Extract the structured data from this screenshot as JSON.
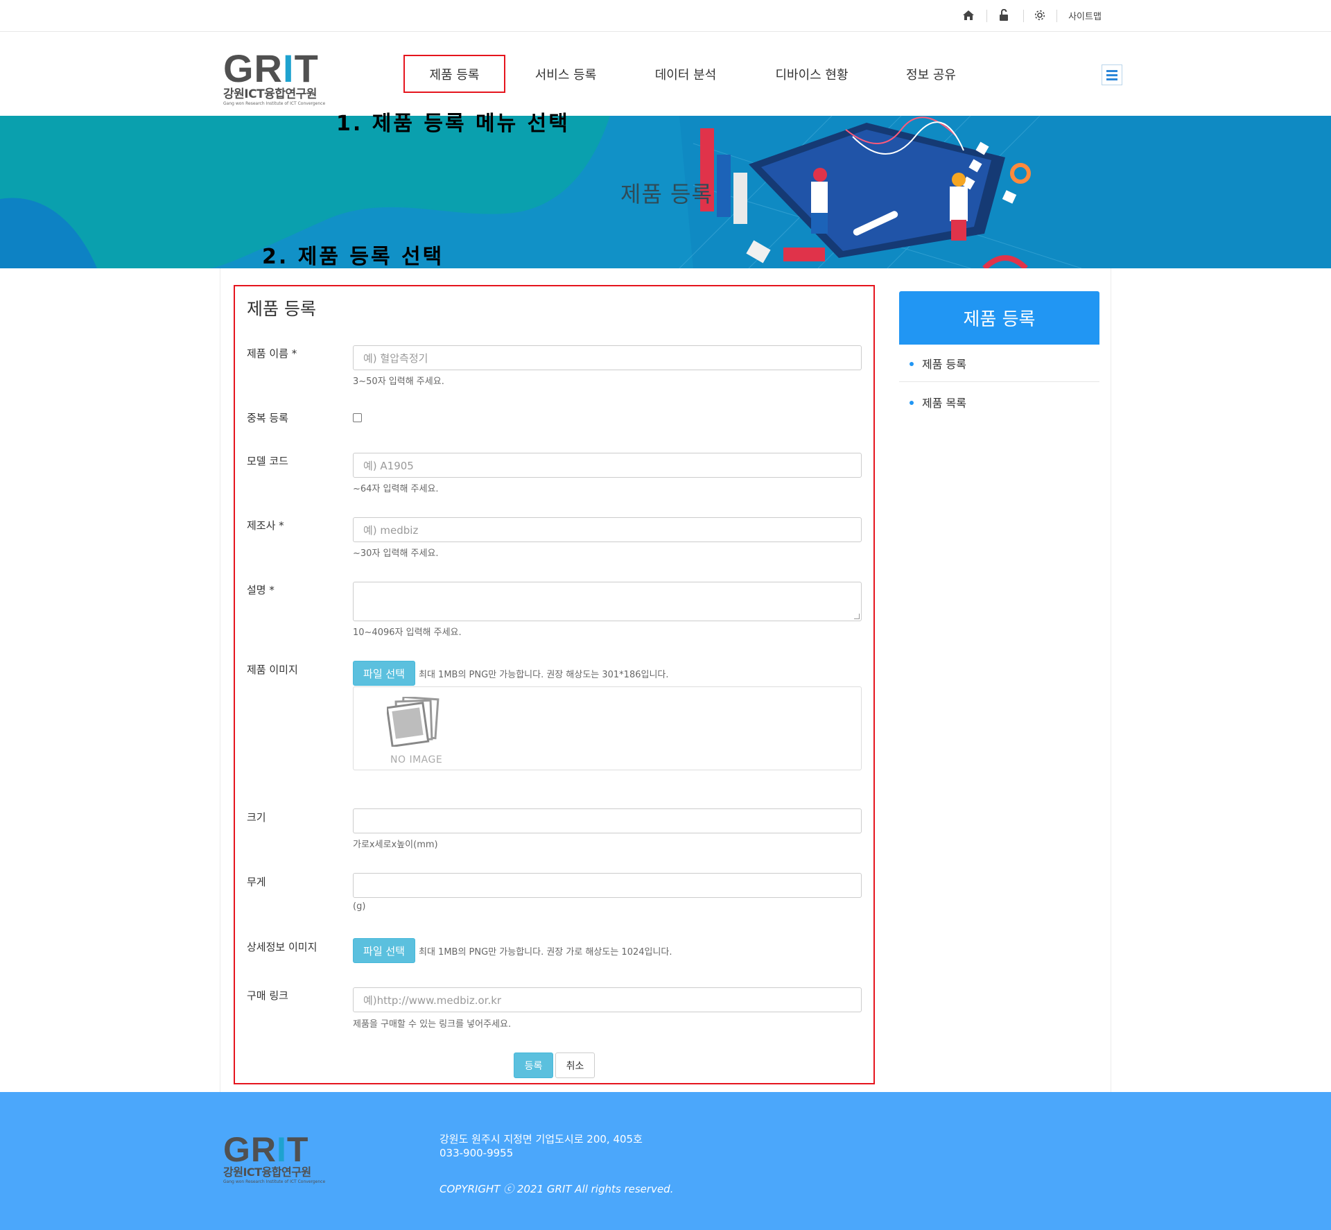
{
  "utilbar": {
    "icons": [
      "home-icon",
      "unlock-icon",
      "gear-icon"
    ],
    "sitemap_label": "사이트맵"
  },
  "header": {
    "logo": {
      "text": "GRIT",
      "korean": "강원ICT융합연구원",
      "english": "Gang won Research Institute of ICT Convergence"
    },
    "nav": [
      "제품 등록",
      "서비스 등록",
      "데이터 분석",
      "디바이스 현황",
      "정보 공유"
    ],
    "menu_icon": "hamburger-menu-icon"
  },
  "banner": {
    "title": "제품 등록"
  },
  "annotations": {
    "step1": "1. 제품 등록 메뉴 선택",
    "step2": "2. 제품 등록 선택"
  },
  "form": {
    "title": "제품 등록",
    "product_name": {
      "label": "제품 이름 *",
      "placeholder": "예) 혈압측정기",
      "help": "3~50자 입력해 주세요."
    },
    "duplicate": {
      "label": "중복 등록",
      "checked": false
    },
    "model_code": {
      "label": "모델 코드",
      "placeholder": "예) A1905",
      "help": "~64자 입력해 주세요."
    },
    "manufacturer": {
      "label": "제조사 *",
      "placeholder": "예) medbiz",
      "help": "~30자 입력해 주세요."
    },
    "description": {
      "label": "설명 *",
      "help": "10~4096자 입력해 주세요."
    },
    "product_image": {
      "label": "제품 이미지",
      "button": "파일 선택",
      "note": "최대 1MB의 PNG만 가능합니다. 권장 해상도는 301*186입니다.",
      "empty_label": "NO IMAGE"
    },
    "size": {
      "label": "크기",
      "help": "가로x세로x높이(mm)"
    },
    "weight": {
      "label": "무게",
      "help": "(g)"
    },
    "detail_image": {
      "label": "상세정보 이미지",
      "button": "파일 선택",
      "note": "최대 1MB의 PNG만 가능합니다. 권장 가로 해상도는 1024입니다."
    },
    "purchase_link": {
      "label": "구매 링크",
      "placeholder": "예)http://www.medbiz.or.kr",
      "help": "제품을 구매할 수 있는 링크를 넣어주세요."
    },
    "submit_label": "등록",
    "cancel_label": "취소"
  },
  "side_menu": {
    "title": "제품 등록",
    "items": [
      "제품 등록",
      "제품 목록"
    ]
  },
  "footer": {
    "address": "강원도 원주시 지정면 기업도시로 200, 405호",
    "phone": "033-900-9955",
    "copyright": "COPYRIGHT ⓒ 2021 GRIT All rights reserved."
  },
  "colors": {
    "accent_blue": "#2196f3",
    "button_info": "#5bc0de",
    "footer_bg": "#4ba7fb",
    "annotation_red": "#e5141d",
    "banner_teal": "#1191c7"
  }
}
